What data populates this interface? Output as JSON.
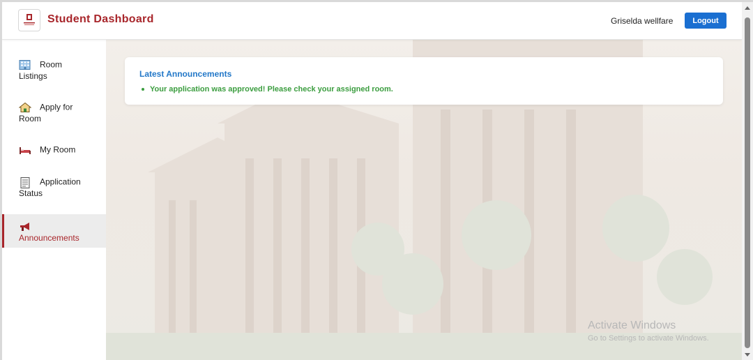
{
  "header": {
    "title": "Student Dashboard",
    "username": "Griselda wellfare",
    "logout_label": "Logout"
  },
  "sidebar": {
    "items": [
      {
        "line1": "Room",
        "line2": "Listings",
        "icon": "building-icon"
      },
      {
        "line1": "Apply for",
        "line2": "Room",
        "icon": "house-icon"
      },
      {
        "line1": "My Room",
        "line2": "",
        "icon": "bed-icon"
      },
      {
        "line1": "Application",
        "line2": "Status",
        "icon": "document-icon"
      },
      {
        "line1": "",
        "line2": "Announcements",
        "icon": "megaphone-icon",
        "active": true
      }
    ]
  },
  "announcements": {
    "title": "Latest Announcements",
    "items": [
      "Your application was approved! Please check your assigned room."
    ]
  },
  "watermark": {
    "line1": "Activate Windows",
    "line2": "Go to Settings to activate Windows."
  },
  "colors": {
    "brand": "#a8262b",
    "accent": "#1a6fd1",
    "heading": "#2378c8",
    "success": "#3b9d3f"
  }
}
